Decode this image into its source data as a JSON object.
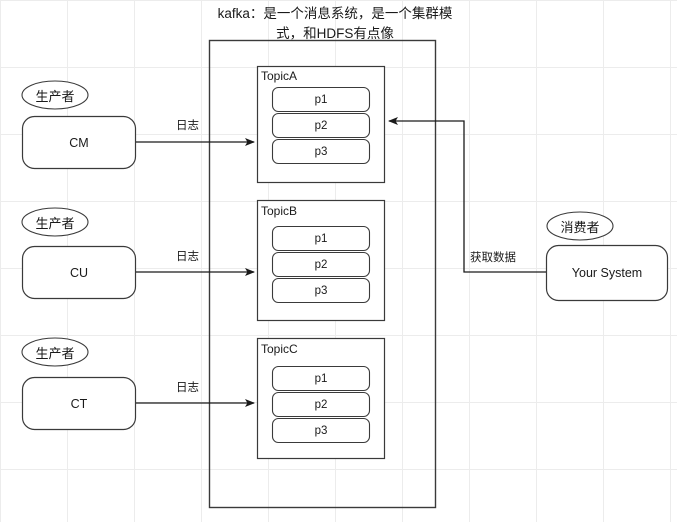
{
  "diagram": {
    "title": "kafka：是一个消息系统，是一个集群模式，和HDFS有点像",
    "title_lines": [
      "kafka：是一个消息系统，是一个集群模",
      "式，和HDFS有点像"
    ],
    "colors": {
      "stroke": "#3a3a3a",
      "grid": "#ececec",
      "background": "#ffffff",
      "text": "#1a1a1a"
    }
  },
  "producers": [
    {
      "role_label": "生产者",
      "name": "CM",
      "edge_label": "日志",
      "target": "TopicA"
    },
    {
      "role_label": "生产者",
      "name": "CU",
      "edge_label": "日志",
      "target": "TopicB"
    },
    {
      "role_label": "生产者",
      "name": "CT",
      "edge_label": "日志",
      "target": "TopicC"
    }
  ],
  "cluster": {
    "label": "",
    "topics": [
      {
        "name": "TopicA",
        "partitions": [
          "p1",
          "p2",
          "p3"
        ]
      },
      {
        "name": "TopicB",
        "partitions": [
          "p1",
          "p2",
          "p3"
        ]
      },
      {
        "name": "TopicC",
        "partitions": [
          "p1",
          "p2",
          "p3"
        ]
      }
    ]
  },
  "consumer": {
    "role_label": "消费者",
    "name": "Your System",
    "edge_label": "获取数据",
    "source": "TopicA"
  }
}
